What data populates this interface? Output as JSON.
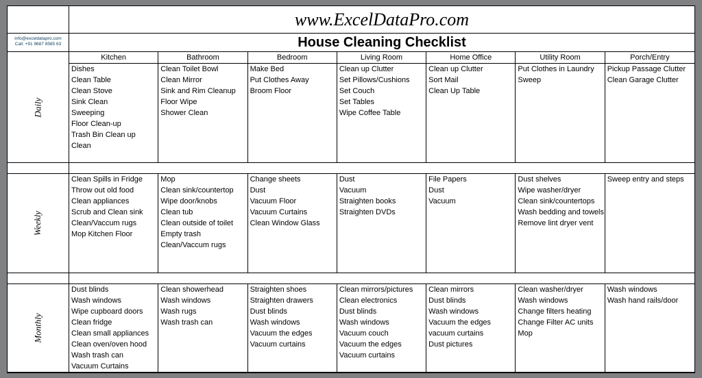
{
  "site_title": "www.ExcelDataPro.com",
  "subtitle": "House Cleaning Checklist",
  "contact_email": "info@exceldatapro.com",
  "contact_phone": "Call: +91 9687 8585 63",
  "logo_name": "exceldatapro-handshake-logo",
  "columns": [
    "Kitchen",
    "Bathroom",
    "Bedroom",
    "Living Room",
    "Home Office",
    "Utility Room",
    "Porch/Entry"
  ],
  "sections": {
    "daily": {
      "label": "Daily",
      "rows": [
        [
          "Dishes",
          "Clean Toilet Bowl",
          "Make Bed",
          "Clean up Clutter",
          "Clean up Clutter",
          "Put Clothes in Laundry",
          "Pickup Passage Clutter"
        ],
        [
          "Clean Table",
          "Clean Mirror",
          "Put Clothes Away",
          "Set Pillows/Cushions",
          "Sort Mail",
          "Sweep",
          "Clean Garage Clutter"
        ],
        [
          "Clean Stove",
          "Sink and Rim Cleanup",
          "Broom Floor",
          "Set Couch",
          "Clean Up Table",
          "",
          ""
        ],
        [
          "Sink Clean",
          "Floor Wipe",
          "",
          "Set Tables",
          "",
          "",
          ""
        ],
        [
          "Sweeping",
          "Shower Clean",
          "",
          "Wipe Coffee Table",
          "",
          "",
          ""
        ],
        [
          "Floor Clean-up",
          "",
          "",
          "",
          "",
          "",
          ""
        ],
        [
          "Trash Bin Clean up",
          "",
          "",
          "",
          "",
          "",
          ""
        ],
        [
          "Clean",
          "",
          "",
          "",
          "",
          "",
          ""
        ],
        [
          "",
          "",
          "",
          "",
          "",
          "",
          ""
        ]
      ]
    },
    "weekly": {
      "label": "Weekly",
      "rows": [
        [
          "Clean Spills in Fridge",
          "Mop",
          "Change sheets",
          "Dust",
          "File Papers",
          "Dust shelves",
          "Sweep entry and steps"
        ],
        [
          "Throw out old food",
          "Clean sink/countertop",
          "Dust",
          "Vacuum",
          "Dust",
          "Wipe washer/dryer",
          ""
        ],
        [
          "Clean appliances",
          "Wipe door/knobs",
          "Vacuum Floor",
          "Straighten books",
          "Vacuum",
          "Clean sink/countertops",
          ""
        ],
        [
          "Scrub and Clean sink",
          "Clean tub",
          "Vacuum Curtains",
          "Straighten DVDs",
          "",
          "Wash bedding and towels",
          ""
        ],
        [
          "Clean/Vaccum rugs",
          "Clean outside of toilet",
          "Clean Window Glass",
          "",
          "",
          "Remove lint dryer vent",
          ""
        ],
        [
          "Mop Kitchen Floor",
          "Empty trash",
          "",
          "",
          "",
          "",
          ""
        ],
        [
          "",
          "Clean/Vaccum rugs",
          "",
          "",
          "",
          "",
          ""
        ],
        [
          "",
          "",
          "",
          "",
          "",
          "",
          ""
        ],
        [
          "",
          "",
          "",
          "",
          "",
          "",
          ""
        ]
      ]
    },
    "monthly": {
      "label": "Monthly",
      "rows": [
        [
          "Dust blinds",
          "Clean showerhead",
          "Straighten shoes",
          "Clean mirrors/pictures",
          "Clean mirrors",
          "Clean washer/dryer",
          "Wash windows"
        ],
        [
          "Wash windows",
          "Wash windows",
          "Straighten drawers",
          "Clean electronics",
          "Dust blinds",
          "Wash windows",
          "Wash hand rails/door"
        ],
        [
          "Wipe cupboard doors",
          "Wash rugs",
          "Dust blinds",
          "Dust blinds",
          "Wash windows",
          "Change filters heating",
          ""
        ],
        [
          "Clean fridge",
          "Wash trash can",
          "Wash windows",
          "Wash windows",
          "Vacuum the edges",
          "Change Filter AC units",
          ""
        ],
        [
          "Clean small appliances",
          "",
          "Vacuum the edges",
          "Vacuum couch",
          "vacuum curtains",
          "Mop",
          ""
        ],
        [
          "Clean oven/oven hood",
          "",
          "Vacuum curtains",
          "Vacuum the edges",
          "Dust pictures",
          "",
          ""
        ],
        [
          "Wash trash can",
          "",
          "",
          "Vacuum curtains",
          "",
          "",
          ""
        ],
        [
          "Vacuum Curtains",
          "",
          "",
          "",
          "",
          "",
          ""
        ]
      ]
    }
  }
}
